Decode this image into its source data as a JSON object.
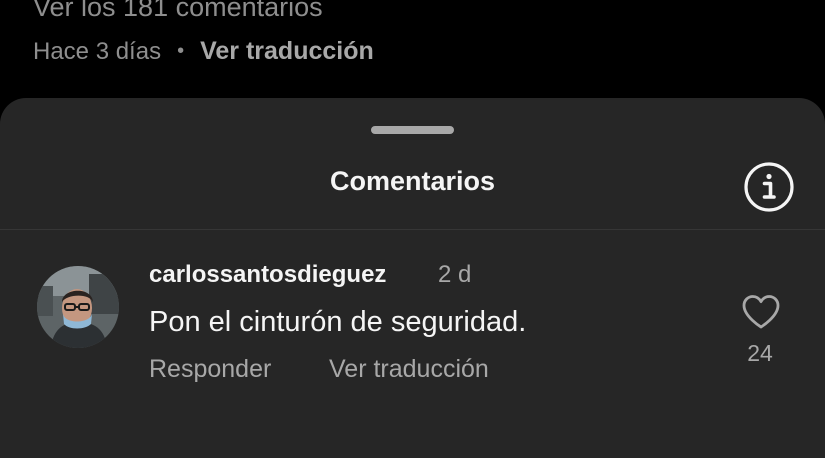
{
  "post": {
    "view_comments": "Ver los 181 comentarios",
    "time": "Hace 3 días",
    "separator": "•",
    "translate": "Ver traducción"
  },
  "sheet": {
    "title": "Comentarios",
    "info_icon": "info-icon",
    "grabber_icon": "drag-handle"
  },
  "comments": [
    {
      "username": "carlossantosdieguez",
      "time": "2 d",
      "text": "Pon el cinturón de seguridad.",
      "reply_label": "Responder",
      "translate_label": "Ver traducción",
      "likes": "24",
      "like_icon": "heart-outline-icon"
    }
  ],
  "colors": {
    "background": "#000000",
    "sheet": "#262626",
    "primary_text": "#f5f5f5",
    "secondary_text": "#a8a8a8",
    "divider": "#363636"
  }
}
